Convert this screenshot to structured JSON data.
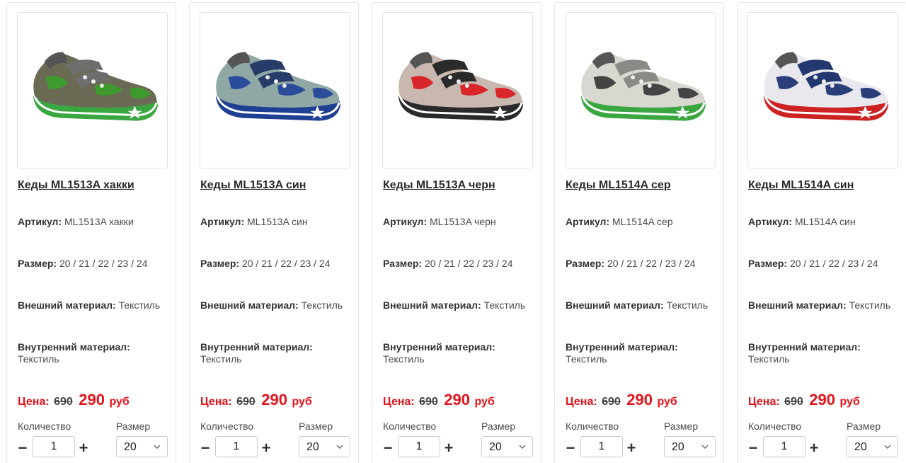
{
  "labels": {
    "article": "Артикул:",
    "size": "Размер:",
    "outer": "Внешний материал:",
    "inner": "Внутренний материал:",
    "price": "Цена:",
    "currency": "руб",
    "qty": "Количество",
    "size_select": "Размер",
    "minus": "−",
    "plus": "+"
  },
  "products": [
    {
      "title": "Кеды ML1513A хакки",
      "article": "ML1513A хакки",
      "sizes": "20 / 21 / 22 / 23 / 24",
      "outer": "Текстиль",
      "inner": "Текстиль",
      "old_price": "690",
      "new_price": "290",
      "qty": "1",
      "size_selected": "20",
      "colors": {
        "upper": "#6b6b55",
        "accent": "#3f9a2e",
        "sole": "#3aa640",
        "strap": "#6e6e6e"
      }
    },
    {
      "title": "Кеды ML1513A син",
      "article": "ML1513A син",
      "sizes": "20 / 21 / 22 / 23 / 24",
      "outer": "Текстиль",
      "inner": "Текстиль",
      "old_price": "690",
      "new_price": "290",
      "qty": "1",
      "size_selected": "20",
      "colors": {
        "upper": "#8fa8a6",
        "accent": "#2a4c9a",
        "sole": "#1f3f93",
        "strap": "#283c6a"
      }
    },
    {
      "title": "Кеды ML1513A черн",
      "article": "ML1513A черн",
      "sizes": "20 / 21 / 22 / 23 / 24",
      "outer": "Текстиль",
      "inner": "Текстиль",
      "old_price": "690",
      "new_price": "290",
      "qty": "1",
      "size_selected": "20",
      "colors": {
        "upper": "#c8b8b0",
        "accent": "#d8262a",
        "sole": "#2a2a2a",
        "strap": "#2a2a2a"
      }
    },
    {
      "title": "Кеды ML1514A сер",
      "article": "ML1514A сер",
      "sizes": "20 / 21 / 22 / 23 / 24",
      "outer": "Текстиль",
      "inner": "Текстиль",
      "old_price": "690",
      "new_price": "290",
      "qty": "1",
      "size_selected": "20",
      "colors": {
        "upper": "#d8d8d0",
        "accent": "#444444",
        "sole": "#3aa640",
        "strap": "#8a8a86"
      }
    },
    {
      "title": "Кеды ML1514A син",
      "article": "ML1514A син",
      "sizes": "20 / 21 / 22 / 23 / 24",
      "outer": "Текстиль",
      "inner": "Текстиль",
      "old_price": "690",
      "new_price": "290",
      "qty": "1",
      "size_selected": "20",
      "colors": {
        "upper": "#e8e8ee",
        "accent": "#2a3f7a",
        "sole": "#cc2222",
        "strap": "#23386e"
      }
    }
  ]
}
